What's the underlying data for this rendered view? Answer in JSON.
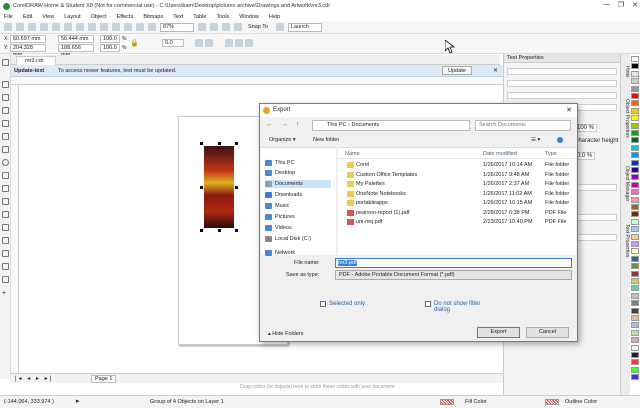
{
  "app": {
    "title": "CorelDRAW Home & Student X8 (Not for commercial use) - C:\\Users\\bam\\Desktop\\pictures archive\\Drawings and Artwork\\mr3.cdr",
    "window_buttons": [
      "—",
      "❐",
      "✕"
    ]
  },
  "menu": [
    "File",
    "Edit",
    "View",
    "Layout",
    "Object",
    "Effects",
    "Bitmaps",
    "Text",
    "Table",
    "Tools",
    "Window",
    "Help"
  ],
  "toolbar": {
    "zoom": "87%",
    "snap_to": "Snap To",
    "launch": "Launch"
  },
  "property_bar": {
    "x": "60.697 mm",
    "y": "204.328 mm",
    "width": "56.444 mm",
    "height": "188.656 mm",
    "scale_x": "100.0",
    "scale_y": "100.0",
    "pct": "%",
    "angle": "0.0"
  },
  "doc_tab": "mr3.cdr",
  "update_bar": {
    "label": "Update-text",
    "message": "To access newer features, text must be updated.",
    "button": "Update",
    "close": "✕"
  },
  "page_nav": {
    "page_label": "Page 1",
    "hint": "Drag colors (or objects) here to store these colors with your document"
  },
  "status": {
    "coords": "(-144.064, 333.974 )",
    "selection": "Group of 4 Objects on Layer 1",
    "fill": "Fill Color",
    "outline": "Outline Color"
  },
  "docker": {
    "title": "Text Properties",
    "label1": "Character height",
    "value1": "100 %",
    "value2": "0.0 %"
  },
  "docker_tabs": [
    "Hints",
    "Object Properties",
    "Object Manager",
    "Text Properties"
  ],
  "palette": [
    "#ffffff",
    "#000000",
    "#e6e6e6",
    "#cccccc",
    "#999999",
    "#ff0000",
    "#ff6600",
    "#ffcc00",
    "#ffff00",
    "#99cc00",
    "#00aa00",
    "#006633",
    "#00cccc",
    "#0099ff",
    "#0033cc",
    "#330099",
    "#9900cc",
    "#cc0099",
    "#ff66cc",
    "#ff9999",
    "#996633",
    "#663300",
    "#ccffcc",
    "#99ccff",
    "#ffcc99",
    "#cc99ff",
    "#ffffcc",
    "#336699",
    "#669933",
    "#993333",
    "#cccc66",
    "#66cccc",
    "#c0c0c0",
    "#808080",
    "#404040",
    "#e0c0a0",
    "#a0c0e0",
    "#c0e0a0",
    "#e0a0c0",
    "#f0f0f0",
    "#202020",
    "#ff3333",
    "#33ff33",
    "#3333ff"
  ],
  "export_dialog": {
    "title": "Export",
    "path": [
      "This PC",
      "Documents"
    ],
    "search_placeholder": "Search Documents",
    "organize": "Organize ▾",
    "new_folder": "New folder",
    "nav_items": [
      {
        "label": "This PC",
        "icon": "computer-icon",
        "color": "#4a88c7"
      },
      {
        "label": "Desktop",
        "icon": "desktop-icon",
        "color": "#4a88c7"
      },
      {
        "label": "Documents",
        "icon": "documents-icon",
        "color": "#8aa3bd"
      },
      {
        "label": "Downloads",
        "icon": "downloads-icon",
        "color": "#3a7bd5"
      },
      {
        "label": "Music",
        "icon": "music-icon",
        "color": "#4a88c7"
      },
      {
        "label": "Pictures",
        "icon": "pictures-icon",
        "color": "#4a88c7"
      },
      {
        "label": "Videos",
        "icon": "videos-icon",
        "color": "#4a88c7"
      },
      {
        "label": "Local Disk (C:)",
        "icon": "disk-icon",
        "color": "#888888"
      },
      {
        "label": "Network",
        "icon": "network-icon",
        "color": "#4a88c7"
      }
    ],
    "columns": [
      "Name",
      "Date modified",
      "Type"
    ],
    "files": [
      {
        "name": "Corel",
        "date": "1/26/2017 10:14 AM",
        "type": "File folder",
        "kind": "folder"
      },
      {
        "name": "Custom Office Templates",
        "date": "1/26/2017 9:48 AM",
        "type": "File folder",
        "kind": "folder"
      },
      {
        "name": "My Palettes",
        "date": "1/26/2017 2:37 AM",
        "type": "File folder",
        "kind": "folder"
      },
      {
        "name": "OneNote Notebooks",
        "date": "1/26/2017 11:02 AM",
        "type": "File folder",
        "kind": "folder"
      },
      {
        "name": "portableapps",
        "date": "1/26/2017 10:15 AM",
        "type": "File folder",
        "kind": "folder"
      },
      {
        "name": "pearson-report (1).pdf",
        "date": "2/28/2017 6:38 PM",
        "type": "PDF File",
        "kind": "pdf"
      },
      {
        "name": "uni-req.pdf",
        "date": "2/23/2017 10:40 PM",
        "type": "PDF File",
        "kind": "pdf"
      }
    ],
    "file_name_label": "File name:",
    "file_name_value": "mr3.pdf",
    "save_type_label": "Save as type:",
    "save_type_value": "PDF - Adobe Portable Document Format (*.pdf)",
    "selected_only": "Selected only",
    "no_filter": "Do not show filter dialog",
    "hide_folders": "Hide Folders",
    "export_button": "Export",
    "cancel_button": "Cancel"
  }
}
